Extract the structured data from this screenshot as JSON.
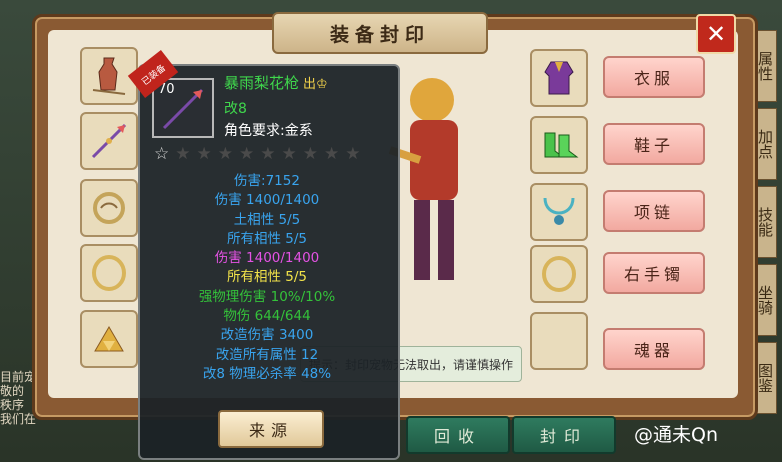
{
  "window": {
    "title": "装备封印",
    "close_glyph": "✕"
  },
  "right_slots": [
    {
      "icon": "robe-icon",
      "button": "衣服"
    },
    {
      "icon": "shoes-icon",
      "button": "鞋子"
    },
    {
      "icon": "necklace-icon",
      "button": "项链"
    },
    {
      "icon": "bracelet-icon",
      "button": "右手镯"
    },
    {
      "icon": "empty-slot",
      "button": "魂器"
    }
  ],
  "left_slots": [
    {
      "icon": "vase-icon"
    },
    {
      "icon": "spear-icon"
    },
    {
      "icon": "jade-ring-icon"
    },
    {
      "icon": "bracelet-icon"
    },
    {
      "icon": "gold-item-icon"
    }
  ],
  "hint_text": "提示：封印宠物无法取出，请谨慎操作",
  "bottom_buttons": [
    "回收",
    "封印"
  ],
  "background_right_tabs": [
    "属性",
    "加点",
    "技能",
    "坐骑",
    "图鉴"
  ],
  "background_left_text": "目前宠\n敬的\n秩序\n我们在",
  "tooltip": {
    "level": "70",
    "ribbon": "已装备",
    "name": "暴雨梨花枪",
    "name_badge": "出♔",
    "mod_level": "改8",
    "requirement": "角色要求:金系",
    "stars_total": 10,
    "stars_filled": 0,
    "lines": [
      {
        "text": "伤害:7152",
        "color": "blue"
      },
      {
        "text": "伤害 1400/1400",
        "color": "blue"
      },
      {
        "text": "土相性 5/5",
        "color": "blue"
      },
      {
        "text": "所有相性 5/5",
        "color": "blue"
      },
      {
        "text": "伤害 1400/1400",
        "color": "pink"
      },
      {
        "text": "所有相性 5/5",
        "color": "yellow"
      },
      {
        "text": "强物理伤害 10%/10%",
        "color": "green"
      },
      {
        "text": "物伤 644/644",
        "color": "green"
      },
      {
        "text": "改造伤害 3400",
        "color": "blue"
      },
      {
        "text": "改造所有属性 12",
        "color": "blue"
      },
      {
        "text": "改8 物理必杀率 48%",
        "color": "blue"
      }
    ],
    "source_button": "来源"
  },
  "watermark": "@通未Qn",
  "colors": {
    "frame": "#8a5a33",
    "pink_button": "#f2a9a0",
    "green_button": "#2f7b5f",
    "tooltip_bg": "#1c2226",
    "close_red": "#c0291c"
  }
}
